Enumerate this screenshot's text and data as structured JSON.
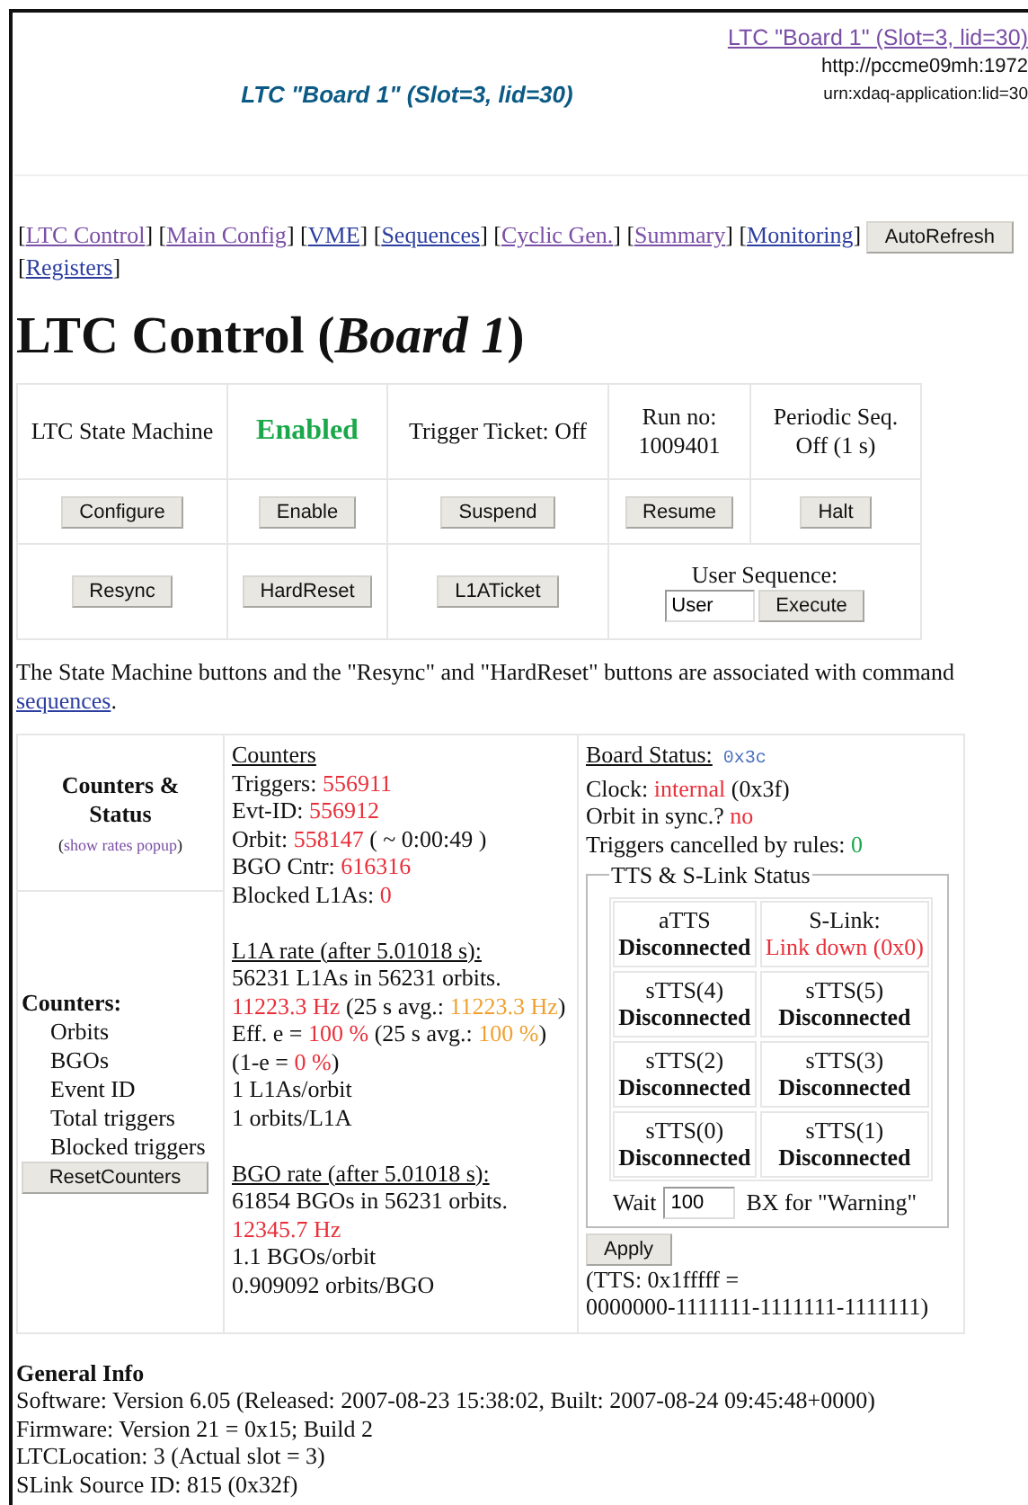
{
  "header": {
    "title": "LTC \"Board 1\" (Slot=3, lid=30)",
    "app_link": "LTC \"Board 1\" (Slot=3, lid=30)",
    "url": "http://pccme09mh:1972",
    "urn": "urn:xdaq-application:lid=30"
  },
  "brackets": [
    "[",
    "]"
  ],
  "nav": [
    {
      "kind": "link",
      "label": "LTC Control",
      "visited": true
    },
    {
      "kind": "link",
      "label": "Main Config",
      "visited": true
    },
    {
      "kind": "link",
      "label": "VME",
      "visited": false
    },
    {
      "kind": "link",
      "label": "Sequences",
      "visited": false
    },
    {
      "kind": "link",
      "label": "Cyclic Gen.",
      "visited": true
    },
    {
      "kind": "link",
      "label": "Summary",
      "visited": true
    },
    {
      "kind": "link",
      "label": "Monitoring",
      "visited": false
    },
    {
      "kind": "button",
      "label": "AutoRefresh"
    },
    {
      "kind": "link",
      "label": "Registers",
      "visited": false
    }
  ],
  "heading": "LTC Control (*Board 1*)",
  "state_machine": {
    "label": "LTC State Machine",
    "state": "Enabled",
    "trigger_ticket": "Trigger Ticket: Off",
    "run_no": "Run no: 1009401",
    "periodic_seq": "Periodic Seq. Off (1 s)",
    "buttons": [
      "Configure",
      "Enable",
      "Suspend",
      "Resume",
      "Halt"
    ],
    "buttons_2": [
      "Resync",
      "HardReset",
      "L1ATicket"
    ],
    "user_sequence": {
      "label": "User Sequence:",
      "value": "User",
      "button": "Execute"
    }
  },
  "note": {
    "text": "The State Machine buttons and the \"Resync\" and \"HardReset\" buttons are associated with command ",
    "link": "sequences",
    "after": "."
  },
  "counters_status": {
    "title": "Counters & Status",
    "popup": [
      "(",
      "show rates popup",
      ")"
    ],
    "counters_label": "Counters:",
    "counters": [
      "Orbits",
      "BGOs",
      "Event ID",
      "Total triggers",
      "Blocked triggers"
    ],
    "reset_button": "ResetCounters"
  },
  "rates": [
    {
      "heading": "Counters",
      "lines": [
        [
          {
            "text": "Triggers: "
          },
          {
            "text": "556911",
            "color": "#e8303a"
          }
        ],
        [
          {
            "text": "Evt-ID: "
          },
          {
            "text": "556912",
            "color": "#e8303a"
          }
        ],
        [
          {
            "text": "Orbit: "
          },
          {
            "text": "558147",
            "color": "#e8303a"
          },
          {
            "text": " ( ~ 0:00:49 )"
          }
        ],
        [
          {
            "text": "BGO Cntr: "
          },
          {
            "text": "616316",
            "color": "#e8303a"
          }
        ],
        [
          {
            "text": "Blocked L1As: "
          },
          {
            "text": "0",
            "color": "#e8303a"
          }
        ]
      ]
    },
    {
      "heading": "L1A rate (after 5.01018 s):",
      "lines": [
        [
          {
            "text": "56231 L1As in 56231 orbits."
          }
        ],
        [
          {
            "text": "11223.3 Hz",
            "color": "#e8303a"
          },
          {
            "text": " (25 s avg.: "
          },
          {
            "text": "11223.3 Hz",
            "color": "#f0a030"
          },
          {
            "text": ")"
          }
        ],
        [
          {
            "text": "Eff. e = "
          },
          {
            "text": "100 %",
            "color": "#e8303a"
          },
          {
            "text": " (25 s avg.: "
          },
          {
            "text": "100 %",
            "color": "#f0a030"
          },
          {
            "text": ")"
          }
        ],
        [
          {
            "text": "(1-e = "
          },
          {
            "text": "0 %",
            "color": "#e8303a"
          },
          {
            "text": ")"
          }
        ],
        [
          {
            "text": "1 L1As/orbit"
          }
        ],
        [
          {
            "text": "1 orbits/L1A"
          }
        ]
      ]
    },
    {
      "heading": "BGO rate (after 5.01018 s):",
      "lines": [
        [
          {
            "text": "61854 BGOs in 56231 orbits."
          }
        ],
        [
          {
            "text": "12345.7 Hz",
            "color": "#e8303a"
          }
        ],
        [
          {
            "text": "1.1 BGOs/orbit"
          }
        ],
        [
          {
            "text": "0.909092 orbits/BGO"
          }
        ]
      ]
    }
  ],
  "board_status": {
    "heading": "Board Status:",
    "code": "0x3c",
    "lines": [
      [
        {
          "text": "Clock: "
        },
        {
          "text": "internal",
          "color": "#e8303a"
        },
        {
          "text": " (0x3f)"
        }
      ],
      [
        {
          "text": "Orbit in sync.? "
        },
        {
          "text": "no",
          "color": "#e8303a"
        }
      ],
      [
        {
          "text": "Triggers cancelled by rules: "
        },
        {
          "text": "0",
          "color": "#1aa84a"
        }
      ]
    ],
    "tts_title": "TTS & S-Link Status",
    "tts": [
      {
        "label": "aTTS",
        "status": "Disconnected",
        "bold": true
      },
      {
        "label": "S-Link:",
        "status": "Link down (0x0)",
        "bold": false,
        "color": "#e8303a"
      },
      {
        "label": "sTTS(4)",
        "status": "Disconnected",
        "bold": true
      },
      {
        "label": "sTTS(5)",
        "status": "Disconnected",
        "bold": true
      },
      {
        "label": "sTTS(2)",
        "status": "Disconnected",
        "bold": true
      },
      {
        "label": "sTTS(3)",
        "status": "Disconnected",
        "bold": true
      },
      {
        "label": "sTTS(0)",
        "status": "Disconnected",
        "bold": true
      },
      {
        "label": "sTTS(1)",
        "status": "Disconnected",
        "bold": true
      }
    ],
    "wait_label": "Wait",
    "wait_value": "100",
    "wait_after": "BX for \"Warning\"",
    "apply_button": "Apply",
    "tts_summary": "(TTS: 0x1fffff = 0000000-1111111-1111111-1111111)"
  },
  "general_info": {
    "heading": "General Info",
    "lines": [
      "Software: Version 6.05 (Released: 2007-08-23 15:38:02, Built: 2007-08-24 09:45:48+0000)",
      "Firmware: Version 21 = 0x15; Build 2",
      "LTCLocation: 3 (Actual slot = 3)",
      "SLink Source ID: 815 (0x32f)"
    ]
  }
}
